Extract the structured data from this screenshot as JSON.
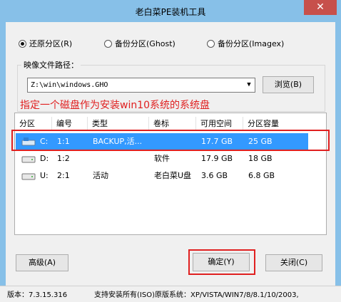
{
  "window": {
    "title": "老白菜PE装机工具",
    "close_label": "✕"
  },
  "modes": [
    {
      "label": "还原分区(R)",
      "selected": true
    },
    {
      "label": "备份分区(Ghost)",
      "selected": false
    },
    {
      "label": "备份分区(Imagex)",
      "selected": false
    }
  ],
  "image_path": {
    "label": "映像文件路径：",
    "value": "Z:\\win\\windows.GHO",
    "browse_label": "浏览(B)"
  },
  "annotation": "指定一个磁盘作为安装win10系统的系统盘",
  "table": {
    "columns": [
      "分区",
      "编号",
      "类型",
      "卷标",
      "可用空间",
      "分区容量"
    ],
    "rows": [
      {
        "partition": "C:",
        "number": "1:1",
        "type": "BACKUP,活...",
        "label": "",
        "free": "17.7 GB",
        "capacity": "25 GB",
        "selected": true,
        "icon": "windows-drive-icon"
      },
      {
        "partition": "D:",
        "number": "1:2",
        "type": "",
        "label": "软件",
        "free": "17.9 GB",
        "capacity": "18 GB",
        "selected": false,
        "icon": "hard-drive-icon"
      },
      {
        "partition": "U:",
        "number": "2:1",
        "type": "活动",
        "label": "老白菜U盘",
        "free": "3.6 GB",
        "capacity": "6.8 GB",
        "selected": false,
        "icon": "usb-drive-icon"
      }
    ]
  },
  "buttons": {
    "advanced": "高级(A)",
    "ok": "确定(Y)",
    "close": "关闭(C)"
  },
  "status": {
    "version": "版本：7.3.15.316",
    "support": "支持安装所有(ISO)原版系统：XP/VISTA/WIN7/8/8.1/10/2003,"
  },
  "colors": {
    "title_bg": "#87c0e8",
    "selected_row": "#3399ff",
    "annotation": "#e02020",
    "close_button": "#c7504b"
  }
}
